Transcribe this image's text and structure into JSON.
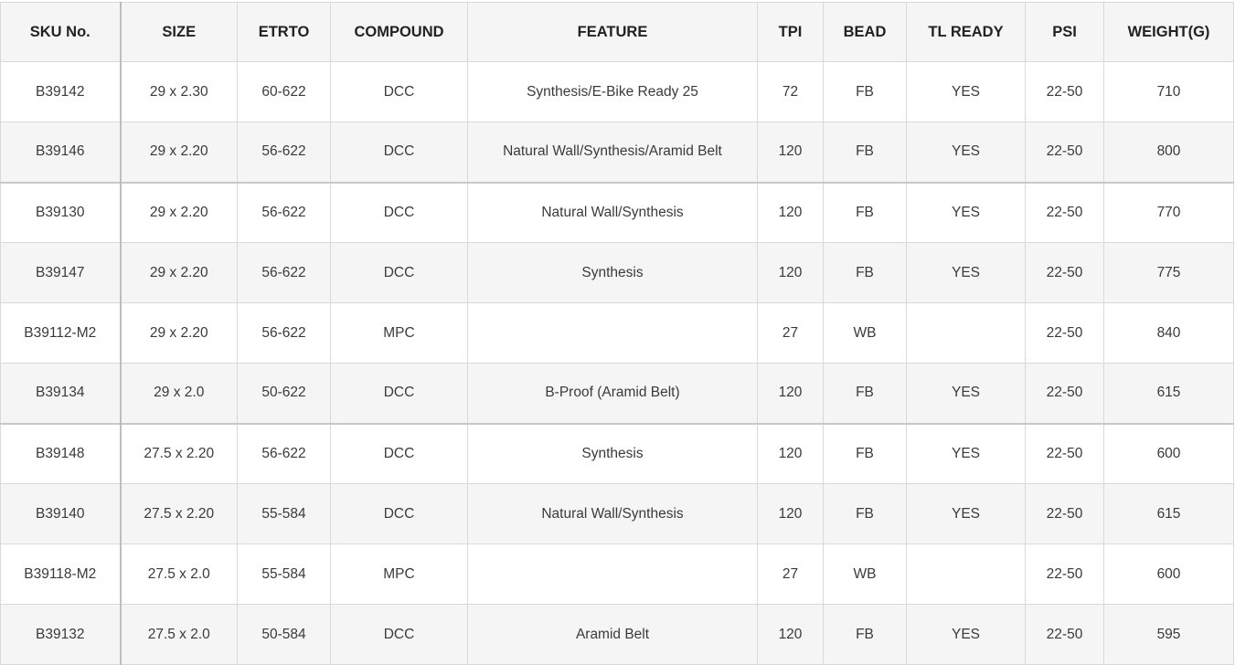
{
  "table": {
    "headers": [
      "SKU No.",
      "SIZE",
      "ETRTO",
      "COMPOUND",
      "FEATURE",
      "TPI",
      "BEAD",
      "TL READY",
      "PSI",
      "WEIGHT(G)"
    ],
    "rows": [
      [
        "B39142",
        "29 x 2.30",
        "60-622",
        "DCC",
        "Synthesis/E-Bike Ready 25",
        "72",
        "FB",
        "YES",
        "22-50",
        "710"
      ],
      [
        "B39146",
        "29 x 2.20",
        "56-622",
        "DCC",
        "Natural Wall/Synthesis/Aramid Belt",
        "120",
        "FB",
        "YES",
        "22-50",
        "800"
      ],
      [
        "B39130",
        "29 x 2.20",
        "56-622",
        "DCC",
        "Natural Wall/Synthesis",
        "120",
        "FB",
        "YES",
        "22-50",
        "770"
      ],
      [
        "B39147",
        "29 x 2.20",
        "56-622",
        "DCC",
        "Synthesis",
        "120",
        "FB",
        "YES",
        "22-50",
        "775"
      ],
      [
        "B39112-M2",
        "29 x 2.20",
        "56-622",
        "MPC",
        "",
        "27",
        "WB",
        "",
        "22-50",
        "840"
      ],
      [
        "B39134",
        "29 x 2.0",
        "50-622",
        "DCC",
        "B-Proof (Aramid Belt)",
        "120",
        "FB",
        "YES",
        "22-50",
        "615"
      ],
      [
        "B39148",
        "27.5 x 2.20",
        "56-622",
        "DCC",
        "Synthesis",
        "120",
        "FB",
        "YES",
        "22-50",
        "600"
      ],
      [
        "B39140",
        "27.5 x 2.20",
        "55-584",
        "DCC",
        "Natural Wall/Synthesis",
        "120",
        "FB",
        "YES",
        "22-50",
        "615"
      ],
      [
        "B39118-M2",
        "27.5 x 2.0",
        "55-584",
        "MPC",
        "",
        "27",
        "WB",
        "",
        "22-50",
        "600"
      ],
      [
        "B39132",
        "27.5 x 2.0",
        "50-584",
        "DCC",
        "Aramid Belt",
        "120",
        "FB",
        "YES",
        "22-50",
        "595"
      ]
    ]
  }
}
